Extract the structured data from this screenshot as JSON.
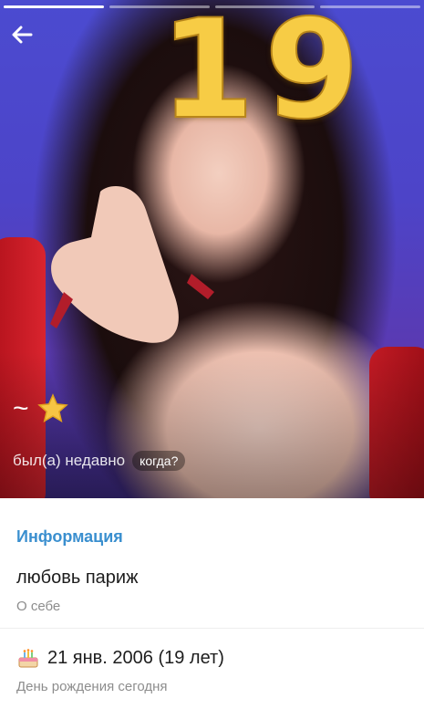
{
  "header": {
    "story_segments": 4,
    "active_segment": 0,
    "balloon_text_1": "1",
    "balloon_text_2": "9"
  },
  "profile": {
    "name": "~",
    "name_emoji_icon": "star-icon",
    "status": "был(а) недавно",
    "when_button": "когда?"
  },
  "info": {
    "title": "Информация",
    "about_value": "любовь париж",
    "about_label": "О себе",
    "birthday_icon": "cake-icon",
    "birthday_value": "21 янв. 2006 (19 лет)",
    "birthday_label": "День рождения сегодня"
  },
  "colors": {
    "accent": "#3a8fcf",
    "balloon_gold": "#f7cc45"
  }
}
